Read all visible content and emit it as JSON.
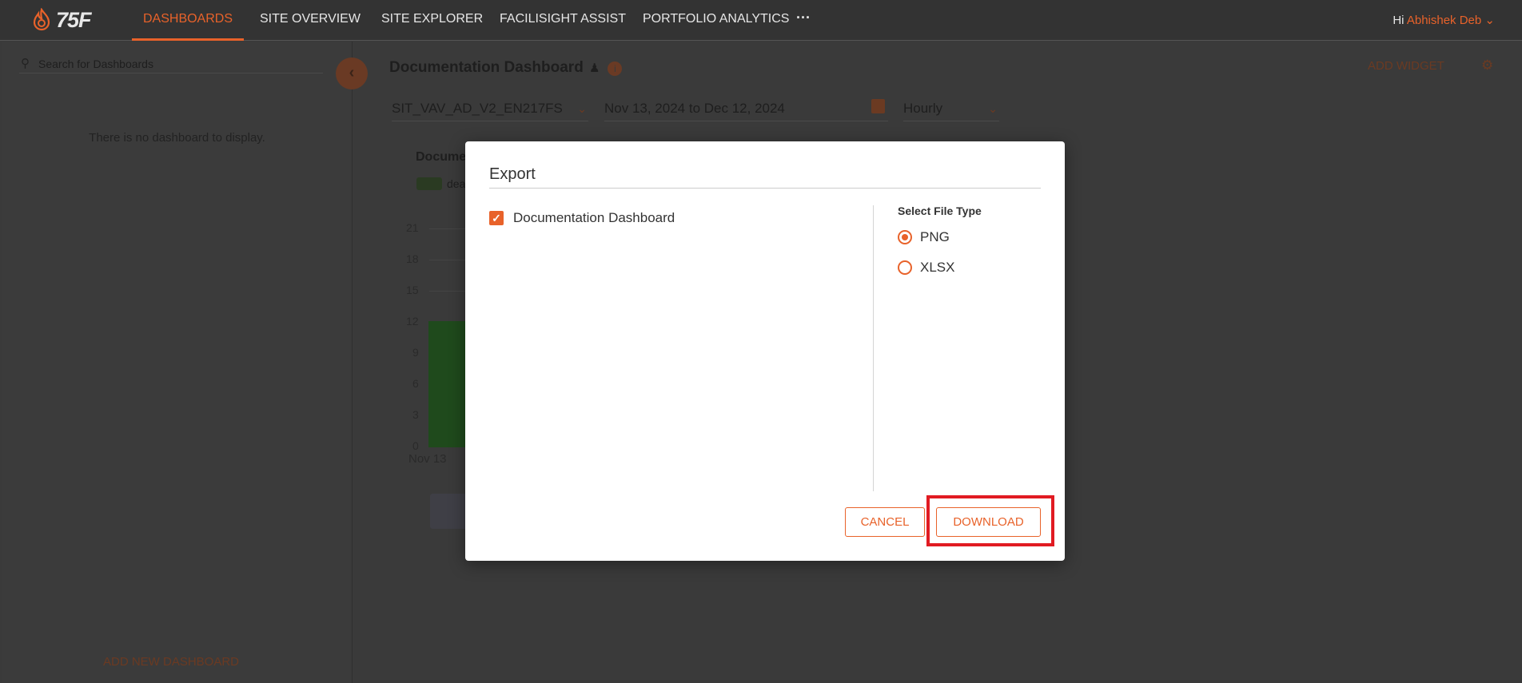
{
  "nav": {
    "logo_text": "75F",
    "items": [
      {
        "label": "DASHBOARDS",
        "active": true
      },
      {
        "label": "SITE OVERVIEW"
      },
      {
        "label": "SITE EXPLORER"
      },
      {
        "label": "FACILISIGHT ASSIST"
      },
      {
        "label": "PORTFOLIO ANALYTICS"
      }
    ],
    "more": "···",
    "greeting": "Hi",
    "user_name": "Abhishek Deb",
    "user_chevron": "⌄"
  },
  "sidebar": {
    "search_placeholder": "Search for Dashboards",
    "empty_text": "There is no dashboard to display.",
    "add_dashboard": "ADD NEW DASHBOARD",
    "collapse_icon": "‹"
  },
  "main": {
    "title": "Documentation Dashboard",
    "add_widget": "ADD WIDGET",
    "device_select": "SIT_VAV_AD_V2_EN217FS",
    "date_range": "Nov 13, 2024 to Dec 12, 2024",
    "interval_select": "Hourly",
    "chart_title_partial": "Docume",
    "chart_legend_partial": "dea",
    "y_ticks": [
      "21",
      "18",
      "15",
      "12",
      "9",
      "6",
      "3",
      "0"
    ],
    "x_tick": "Nov 13"
  },
  "modal": {
    "title": "Export",
    "checkbox_label": "Documentation Dashboard",
    "checkbox_checked": true,
    "file_type_title": "Select File Type",
    "options": [
      {
        "label": "PNG",
        "selected": true
      },
      {
        "label": "XLSX",
        "selected": false
      }
    ],
    "cancel_label": "CANCEL",
    "download_label": "DOWNLOAD"
  },
  "colors": {
    "accent": "#e8622a",
    "highlight": "#e11b22"
  }
}
